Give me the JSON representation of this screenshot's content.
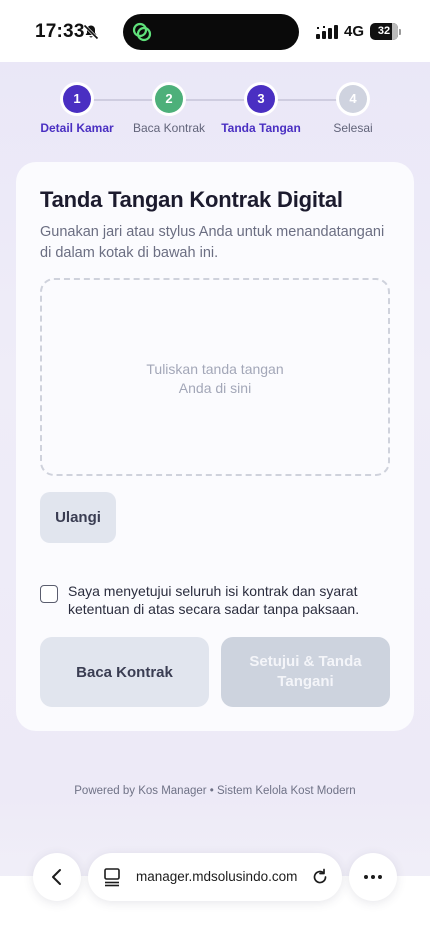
{
  "status_bar": {
    "time": "17:33",
    "network": "4G",
    "battery": "32"
  },
  "stepper": {
    "steps": [
      {
        "number": "1",
        "label": "Detail Kamar",
        "state": "active"
      },
      {
        "number": "2",
        "label": "Baca Kontrak",
        "state": "done"
      },
      {
        "number": "3",
        "label": "Tanda Tangan",
        "state": "active"
      },
      {
        "number": "4",
        "label": "Selesai",
        "state": "pending"
      }
    ]
  },
  "card": {
    "title": "Tanda Tangan Kontrak Digital",
    "description": "Gunakan jari atau stylus Anda untuk menandatangani di dalam kotak di bawah ini.",
    "signature_placeholder_line1": "Tuliskan tanda tangan",
    "signature_placeholder_line2": "Anda di sini",
    "reset_label": "Ulangi",
    "agreement_text": "Saya menyetujui seluruh isi kontrak dan syarat ketentuan di atas secara sadar tanpa paksaan.",
    "agreement_checked": false,
    "read_contract_label": "Baca Kontrak",
    "approve_sign_label": "Setujui & Tanda Tangani"
  },
  "footer": {
    "text": "Powered by Kos Manager • Sistem Kelola Kost Modern"
  },
  "browser": {
    "url": "manager.mdsolusindo.com"
  },
  "colors": {
    "primary": "#4a2fc2",
    "success": "#4db07a",
    "pending": "#cfd3df",
    "disabled_button": "#cdd3de"
  }
}
